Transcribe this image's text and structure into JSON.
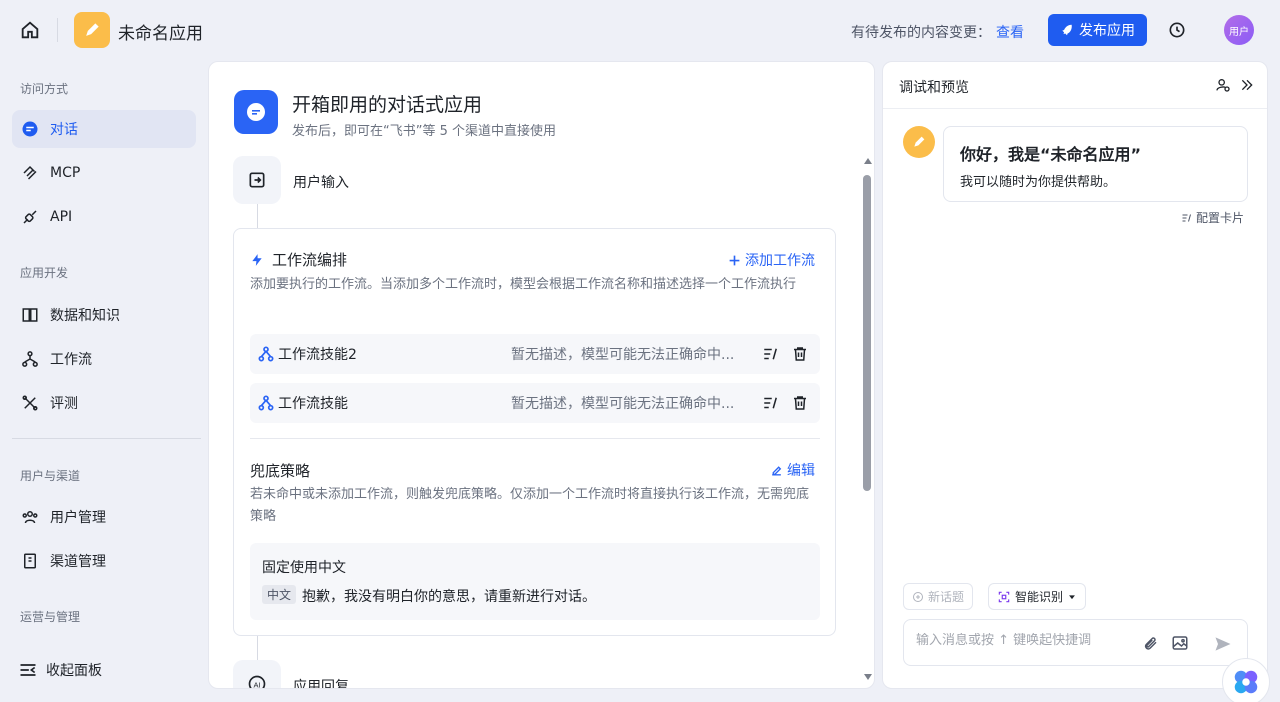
{
  "header": {
    "app_name": "未命名应用",
    "pending_text": "有待发布的内容变更：",
    "pending_link": "查看",
    "publish_label": "发布应用",
    "avatar_text": "用户"
  },
  "sidebar": {
    "sections": [
      "访问方式",
      "应用开发",
      "用户与渠道",
      "运营与管理"
    ],
    "items": [
      {
        "label": "对话",
        "icon": "chat-icon"
      },
      {
        "label": "MCP",
        "icon": "mcp-icon"
      },
      {
        "label": "API",
        "icon": "api-icon"
      },
      {
        "label": "数据和知识",
        "icon": "book-icon"
      },
      {
        "label": "工作流",
        "icon": "workflow-icon"
      },
      {
        "label": "评测",
        "icon": "evaluate-icon"
      },
      {
        "label": "用户管理",
        "icon": "users-icon"
      },
      {
        "label": "渠道管理",
        "icon": "channel-icon"
      }
    ],
    "collapse_label": "收起面板"
  },
  "main": {
    "hero_title": "开箱即用的对话式应用",
    "hero_subtitle": "发布后，即可在“飞书”等 5 个渠道中直接使用",
    "step_input": "用户输入",
    "step_reply": "应用回复",
    "workflow_card": {
      "title": "工作流编排",
      "add_label": "添加工作流",
      "description": "添加要执行的工作流。当添加多个工作流时，模型会根据工作流名称和描述选择一个工作流执行",
      "rows": [
        {
          "name": "工作流技能2",
          "desc": "暂无描述，模型可能无法正确命中..."
        },
        {
          "name": "工作流技能",
          "desc": "暂无描述，模型可能无法正确命中..."
        }
      ],
      "fallback_title": "兜底策略",
      "edit_label": "编辑",
      "fallback_desc": "若未命中或未添加工作流，则触发兜底策略。仅添加一个工作流时将直接执行该工作流，无需兜底策略",
      "fallback_mode": "固定使用中文",
      "fallback_tag": "中文",
      "fallback_text": "抱歉，我没有明白你的意思，请重新进行对话。"
    }
  },
  "preview": {
    "title": "调试和预览",
    "greeting_title": "你好，我是“未命名应用”",
    "greeting_text": "我可以随时为你提供帮助。",
    "config_card": "配置卡片",
    "new_topic": "新话题",
    "mode": "智能识别",
    "input_placeholder": "输入消息或按 ↑ 键唤起快捷调"
  },
  "colors": {
    "accent": "#1f5cf0",
    "app_logo": "#fbbd4a"
  }
}
